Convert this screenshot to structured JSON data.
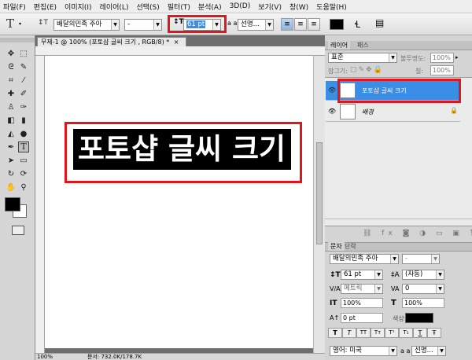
{
  "menubar": {
    "items": [
      "파일(F)",
      "편집(E)",
      "이미지(I)",
      "레이어(L)",
      "선택(S)",
      "필터(T)",
      "분석(A)",
      "3D(D)",
      "보기(V)",
      "창(W)",
      "도움말(H)"
    ]
  },
  "options": {
    "tool_glyph": "T",
    "orient_glyph": "↕T",
    "font_family": "배달의민족 주아",
    "font_style": "-",
    "font_size": "61 pt",
    "aa_label": "a a",
    "aa_value": "선명...",
    "align_left": "≡",
    "align_center": "≡",
    "align_right": "≡",
    "warp_glyph": "Ɬ",
    "panel_glyph": "▤"
  },
  "document": {
    "tab_title": "무제-1 @ 100% (포토샵 글씨 크기 , RGB/8) *",
    "tab_close": "×",
    "canvas_text": "포토샵 글씨 크기",
    "status_zoom": "100%",
    "status_doc": "문서: 732.0K/178.7K"
  },
  "layers_panel": {
    "tabs": [
      "레이어",
      "패스"
    ],
    "blend_mode": "표준",
    "opacity_label": "불투명도:",
    "opacity_value": "100%",
    "lock_label": "잠그기:",
    "fill_label": "칠:",
    "fill_value": "100%",
    "layers": [
      {
        "thumb": "T",
        "name": "포토샵 글씨 크기",
        "selected": true
      },
      {
        "thumb": "",
        "name": "배경",
        "locked": true
      }
    ],
    "footer_icons": "⛓ fx ◙ ◑ ▭ ▣ 🗑"
  },
  "character_panel": {
    "tabs": [
      "문자",
      "단락"
    ],
    "font_family": "배달의민족 주아",
    "font_style": "-",
    "size": "61 pt",
    "leading": "(자동)",
    "kerning": "메트릭",
    "tracking": "0",
    "vscale": "100%",
    "hscale": "100%",
    "baseline": "0 pt",
    "color_label": "색상:",
    "styles": [
      "T",
      "T",
      "TT",
      "Tт",
      "T¹",
      "T₁",
      "T",
      "Ŧ"
    ],
    "language": "영어: 미국",
    "aa_label": "a a",
    "aa_value": "선명..."
  },
  "colors": {
    "highlight_red": "#e0161c",
    "selection_blue": "#3a8ee6",
    "foreground": "#000000",
    "background": "#ffffff"
  }
}
